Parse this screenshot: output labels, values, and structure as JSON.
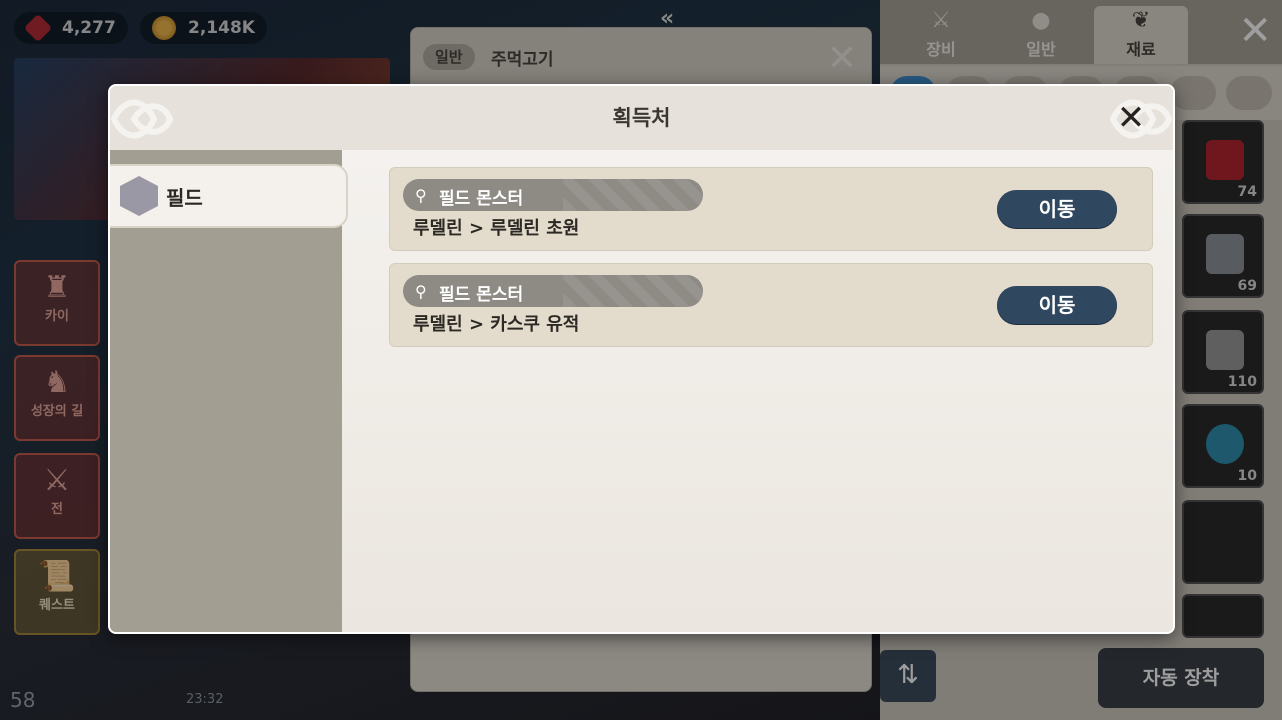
{
  "hud": {
    "ruby_count": "4,277",
    "gold_count": "2,148K",
    "fps": "58",
    "clock": "23:32"
  },
  "sidebar": {
    "kai_label": "카이",
    "growth_label": "성장의 길",
    "combat_label": "전",
    "quest_label": "퀘스트"
  },
  "item_panel": {
    "tag": "일반",
    "name": "주먹고기"
  },
  "inventory": {
    "tabs": [
      {
        "label": "장비",
        "icon": "sword-icon"
      },
      {
        "label": "일반",
        "icon": "pouch-icon"
      },
      {
        "label": "재료",
        "icon": "sprout-icon"
      }
    ],
    "slots": [
      {
        "count": "74",
        "color": "#b4262f"
      },
      {
        "count": "69",
        "color": "#8f9399"
      },
      {
        "count": "110",
        "color": "#9a9a9a"
      },
      {
        "count": "10",
        "color": "#2f8fb0"
      },
      {
        "count": ""
      },
      {
        "count": ""
      }
    ],
    "auto_equip_label": "자동 장착"
  },
  "modal": {
    "title": "획득처",
    "side_tab_label": "필드",
    "sources": [
      {
        "tag": "필드 몬스터",
        "path": "루델린 > 루델린 초원",
        "button": "이동"
      },
      {
        "tag": "필드 몬스터",
        "path": "루델린 > 카스쿠 유적",
        "button": "이동"
      }
    ]
  },
  "colors": {
    "move_button": "#304760",
    "modal_side": "#a39e92",
    "card_bg": "#e3dccd"
  }
}
